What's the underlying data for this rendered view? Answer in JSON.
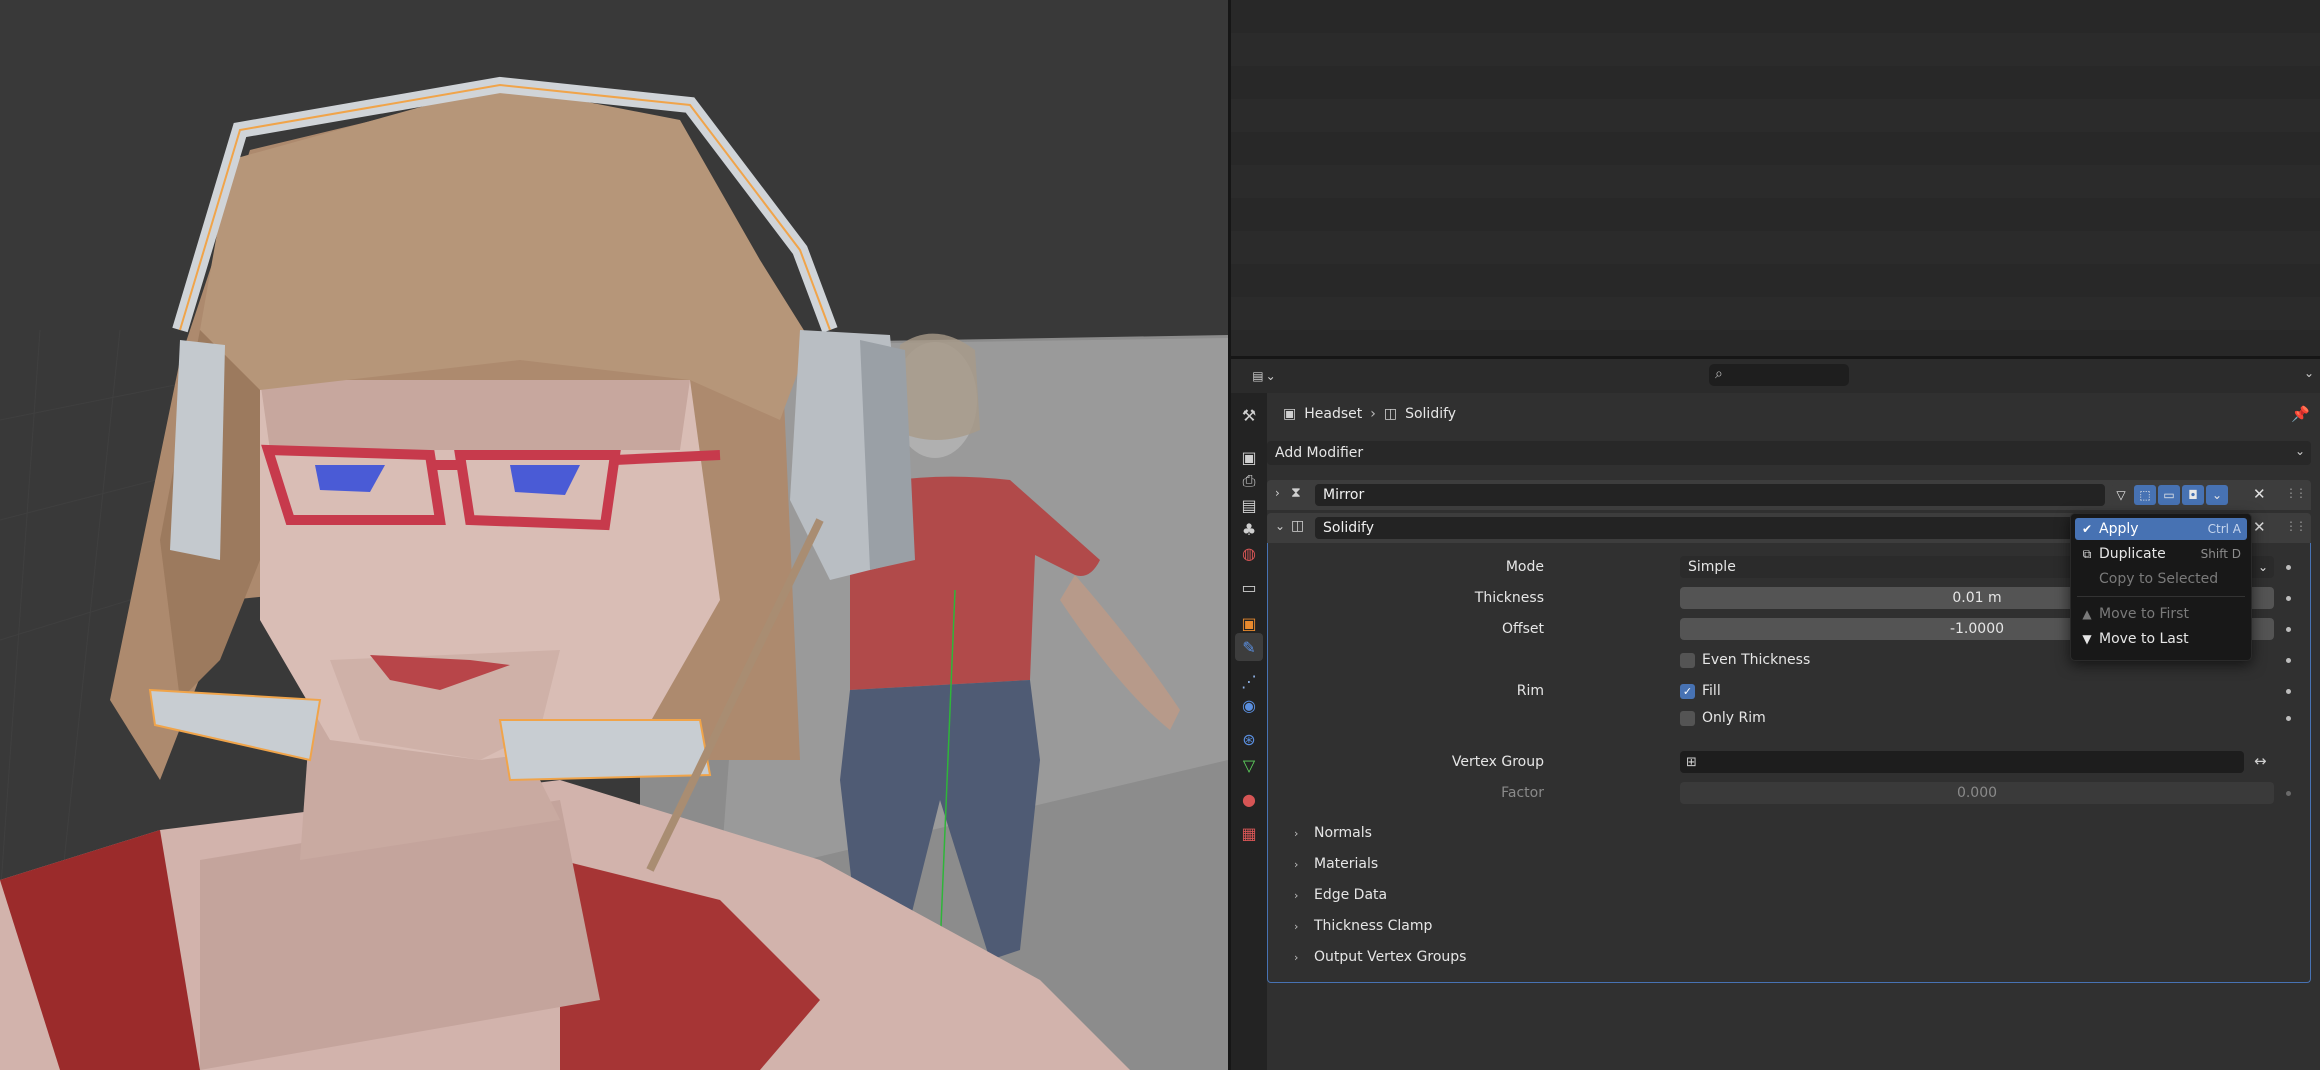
{
  "header": {
    "editor_type_icon": "properties-editor-icon",
    "search_placeholder": "",
    "search_icon": "search-icon"
  },
  "tabs": [
    {
      "name": "tool-tab",
      "icon": "wrench-screwdriver-icon",
      "glyph": "⚒"
    },
    {
      "name": "render-tab",
      "icon": "camera-back-icon",
      "glyph": "▣"
    },
    {
      "name": "output-tab",
      "icon": "printer-icon",
      "glyph": "⎙"
    },
    {
      "name": "view-layer-tab",
      "icon": "image-icon",
      "glyph": "▤"
    },
    {
      "name": "scene-tab",
      "icon": "scene-icon",
      "glyph": "♣"
    },
    {
      "name": "world-tab",
      "icon": "world-icon",
      "glyph": "◍"
    },
    {
      "name": "collection-tab",
      "icon": "collection-icon",
      "glyph": "▭"
    },
    {
      "name": "object-tab",
      "icon": "object-icon",
      "glyph": "▣"
    },
    {
      "name": "modifiers-tab",
      "icon": "wrench-icon",
      "glyph": "🔧"
    },
    {
      "name": "particles-tab",
      "icon": "particles-icon",
      "glyph": "⋰"
    },
    {
      "name": "physics-tab",
      "icon": "physics-icon",
      "glyph": "◉"
    },
    {
      "name": "constraints-tab",
      "icon": "constraint-icon",
      "glyph": "⊛"
    },
    {
      "name": "data-tab",
      "icon": "mesh-data-icon",
      "glyph": "▽"
    },
    {
      "name": "material-tab",
      "icon": "material-icon",
      "glyph": "●"
    },
    {
      "name": "texture-tab",
      "icon": "texture-icon",
      "glyph": "▦"
    }
  ],
  "breadcrumb": {
    "object": "Headset",
    "separator": "›",
    "modifier": "Solidify"
  },
  "add_modifier_label": "Add Modifier",
  "modifiers": {
    "mirror": {
      "name": "Mirror"
    },
    "solidify": {
      "name": "Solidify",
      "mode_label": "Mode",
      "mode_value": "Simple",
      "thickness_label": "Thickness",
      "thickness_value": "0.01 m",
      "offset_label": "Offset",
      "offset_value": "-1.0000",
      "even_thickness_label": "Even Thickness",
      "even_thickness": false,
      "rim_label": "Rim",
      "fill_label": "Fill",
      "fill": true,
      "only_rim_label": "Only Rim",
      "only_rim": false,
      "vertex_group_label": "Vertex Group",
      "vertex_group_value": "",
      "factor_label": "Factor",
      "factor_value": "0.000",
      "subpanels": [
        "Normals",
        "Materials",
        "Edge Data",
        "Thickness Clamp",
        "Output Vertex Groups"
      ]
    }
  },
  "dropdown": {
    "items": [
      {
        "label": "Apply",
        "shortcut": "Ctrl A",
        "state": "active",
        "icon": "check-icon"
      },
      {
        "label": "Duplicate",
        "shortcut": "Shift D",
        "state": "normal",
        "icon": "duplicate-icon"
      },
      {
        "label": "Copy to Selected",
        "shortcut": "",
        "state": "disabled",
        "icon": ""
      },
      {
        "label": "Move to First",
        "shortcut": "",
        "state": "disabled",
        "icon": "triangle-up-icon"
      },
      {
        "label": "Move to Last",
        "shortcut": "",
        "state": "normal",
        "icon": "triangle-down-icon"
      }
    ]
  },
  "colors": {
    "accent": "#4772b3",
    "panel_bg": "#303030",
    "viewport_bg": "#3a3a3a"
  }
}
